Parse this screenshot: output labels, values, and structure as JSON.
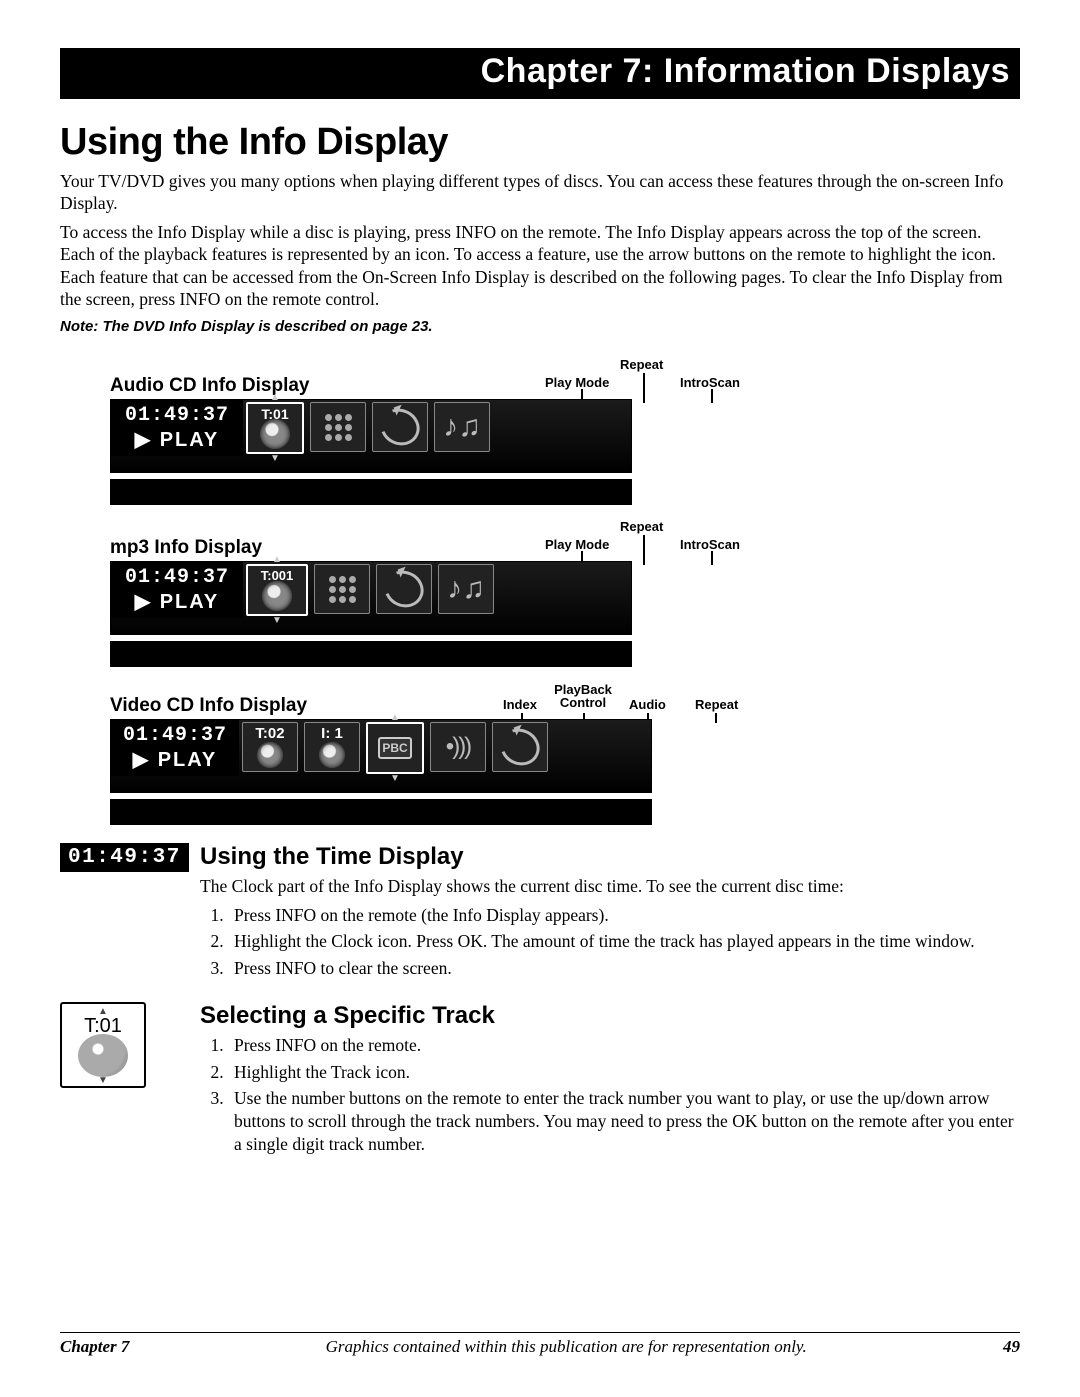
{
  "header": {
    "chapter_banner": "Chapter 7: Information Displays"
  },
  "section": {
    "title": "Using the Info Display",
    "p1": "Your TV/DVD gives you many options when playing different types of discs. You can access these features through the on-screen Info Display.",
    "p2": "To access the Info Display while a disc is playing, press INFO on the remote. The Info Display appears across the top of the screen. Each of the playback features is represented by an icon. To access a feature, use the arrow buttons on the remote to highlight the icon. Each feature that can be accessed from the On-Screen Info Display is described on the following pages. To clear the Info Display from the screen, press INFO on the remote control.",
    "note": "Note: The DVD Info Display is described on page 23."
  },
  "diagrams": {
    "audio": {
      "title": "Audio CD Info Display",
      "labels": {
        "playmode": "Play Mode",
        "repeat": "Repeat",
        "introscan": "IntroScan"
      },
      "time": "01:49:37",
      "play": "PLAY",
      "track": "T:01"
    },
    "mp3": {
      "title": "mp3 Info Display",
      "labels": {
        "playmode": "Play Mode",
        "repeat": "Repeat",
        "introscan": "IntroScan"
      },
      "time": "01:49:37",
      "play": "PLAY",
      "track": "T:001"
    },
    "vcd": {
      "title": "Video CD Info Display",
      "labels": {
        "index": "Index",
        "pbc": "PlayBack Control",
        "audio": "Audio",
        "repeat": "Repeat"
      },
      "time": "01:49:37",
      "play": "PLAY",
      "track": "T:02",
      "index_val": "I: 1",
      "pbc_text": "PBC"
    }
  },
  "time_section": {
    "clock": "01:49:37",
    "title": "Using the Time Display",
    "intro": "The Clock part of the Info Display shows the current disc time. To see the current disc time:",
    "steps": [
      "Press INFO on the remote (the Info Display appears).",
      "Highlight the Clock icon. Press OK. The amount of time the track has played appears in the time window.",
      "Press INFO to clear the screen."
    ]
  },
  "track_section": {
    "icon_label": "T:01",
    "title": "Selecting a Specific Track",
    "steps": [
      "Press INFO on the remote.",
      "Highlight the Track icon.",
      "Use the number buttons on the remote to enter the track number you want to play, or use the up/down arrow buttons to scroll through the track numbers. You may need to press the OK button on the remote after you enter a single digit track number."
    ]
  },
  "footer": {
    "chapter": "Chapter 7",
    "disclaimer": "Graphics contained within this publication are for representation only.",
    "page": "49"
  }
}
